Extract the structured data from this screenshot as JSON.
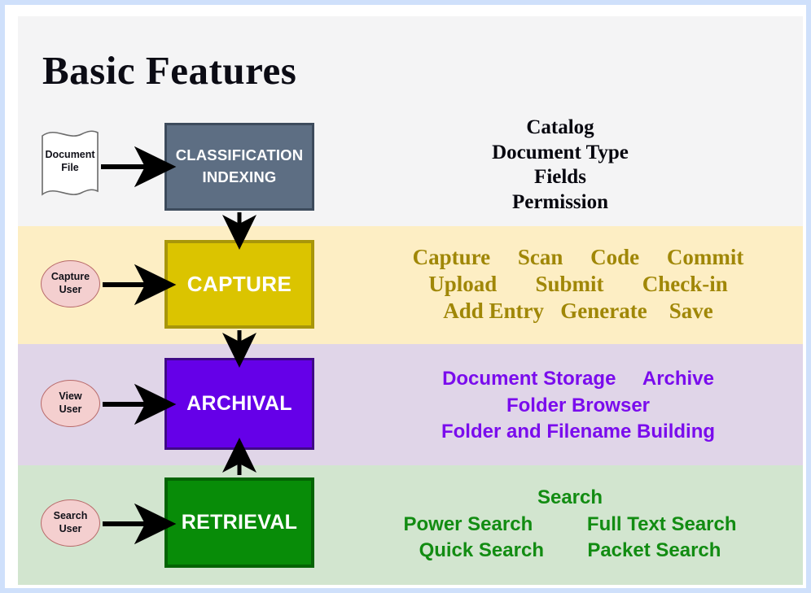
{
  "page": {
    "title": "Basic Features",
    "outer_border_color": "#cfe0fb"
  },
  "bands": [
    {
      "name": "classification",
      "color": "#f4f4f5"
    },
    {
      "name": "capture",
      "color": "#fdeec4"
    },
    {
      "name": "archival",
      "color": "#e0d5e8"
    },
    {
      "name": "retrieval",
      "color": "#d2e5cf"
    }
  ],
  "source": {
    "label_line1": "Document",
    "label_line2": "File",
    "icon": "document-file-icon"
  },
  "boxes": {
    "classification": {
      "line1": "CLASSIFICATION",
      "line2": "INDEXING",
      "fill": "#5d6e83",
      "border": "#3d4b5c"
    },
    "capture": {
      "label": "CAPTURE",
      "fill": "#dbc400",
      "border": "#a8960a"
    },
    "archival": {
      "label": "ARCHIVAL",
      "fill": "#6500e8",
      "border": "#3f0b86"
    },
    "retrieval": {
      "label": "RETRIEVAL",
      "fill": "#088c08",
      "border": "#046404"
    }
  },
  "actors": {
    "capture": {
      "line1": "Capture",
      "line2": "User"
    },
    "view": {
      "line1": "View",
      "line2": "User"
    },
    "search": {
      "line1": "Search",
      "line2": "User"
    }
  },
  "features": {
    "classification": {
      "color": "#07070f",
      "lines": [
        "Catalog",
        "Document Type",
        "Fields",
        "Permission"
      ]
    },
    "capture": {
      "color": "#a08707",
      "lines": [
        "Capture     Scan     Code     Commit",
        "Upload       Submit       Check-in",
        "Add Entry   Generate    Save"
      ]
    },
    "archival": {
      "color": "#7a0ced",
      "lines": [
        "Document Storage     Archive",
        "Folder Browser",
        "Folder and Filename Building"
      ]
    },
    "retrieval": {
      "color": "#128c12",
      "lines": [
        "Search",
        "Power Search          Full Text Search",
        "Quick Search        Packet Search"
      ]
    }
  },
  "arrows": [
    {
      "name": "doc-to-classification",
      "direction": "right"
    },
    {
      "name": "classification-to-capture",
      "direction": "down"
    },
    {
      "name": "capture-user-to-capture",
      "direction": "right"
    },
    {
      "name": "capture-to-archival",
      "direction": "down"
    },
    {
      "name": "view-user-to-archival",
      "direction": "right"
    },
    {
      "name": "retrieval-to-archival",
      "direction": "up"
    },
    {
      "name": "search-user-to-retrieval",
      "direction": "right"
    }
  ]
}
